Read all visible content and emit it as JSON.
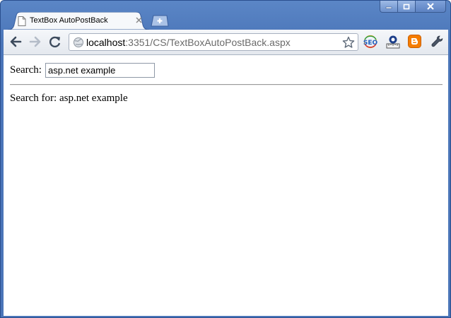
{
  "window": {
    "caption_buttons": [
      "minimize",
      "maximize",
      "close"
    ]
  },
  "tab": {
    "title": "TextBox AutoPostBack",
    "icon": "page-icon"
  },
  "toolbar": {
    "nav_icons": [
      "back-arrow-icon",
      "forward-arrow-icon",
      "reload-icon"
    ],
    "address": {
      "host": "localhost",
      "path": ":3351/CS/TextBoxAutoPostBack.aspx"
    },
    "extensions": [
      "seo-extension-icon",
      "ruler-extension-icon",
      "blogger-extension-icon",
      "wrench-menu-icon"
    ]
  },
  "page": {
    "search_label": "Search:",
    "search_value": "asp.net example",
    "result_text": "Search for: asp.net example"
  },
  "colors": {
    "frame": "#4a75b8",
    "blogger_orange": "#f57d00"
  }
}
